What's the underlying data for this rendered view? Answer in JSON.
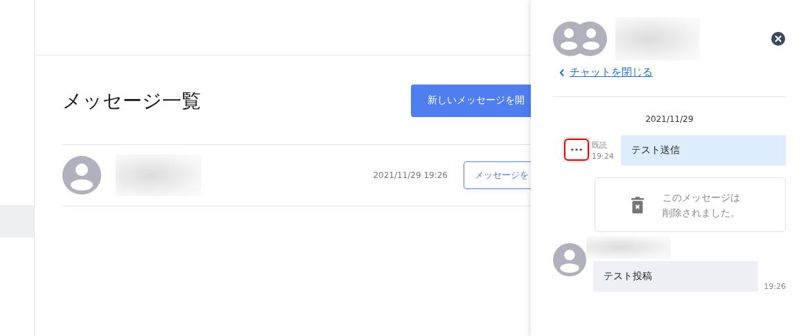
{
  "sidebar": {
    "items": [
      {
        "selected": true
      }
    ]
  },
  "page": {
    "title": "メッセージ一覧",
    "new_button": "新しいメッセージを開"
  },
  "threads": [
    {
      "time": "2021/11/29 19:26",
      "button": "メッセージを"
    }
  ],
  "chat": {
    "close_link": "チャットを閉じる",
    "date": "2021/11/29",
    "messages": [
      {
        "kind": "sent",
        "text": "テスト送信",
        "read": "既読",
        "time": "19:24",
        "menu_highlighted": true
      },
      {
        "kind": "deleted",
        "text": "このメッセージは削除されました。"
      },
      {
        "kind": "received",
        "text": "テスト投稿",
        "time": "19:26"
      }
    ]
  }
}
